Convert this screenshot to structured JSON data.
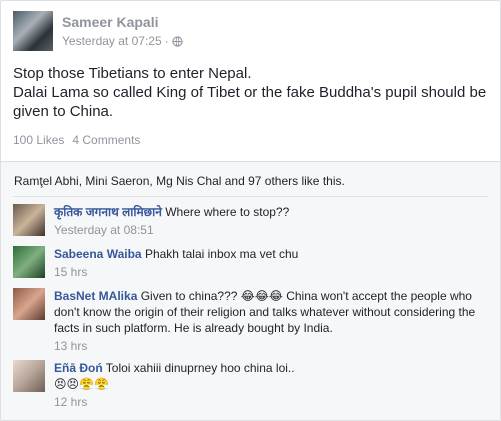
{
  "post": {
    "author": "Sameer Kapali",
    "timestamp": "Yesterday at 07:25",
    "separator": "·",
    "privacy_icon": "globe-icon",
    "text_lines": [
      "Stop those Tibetians to enter Nepal.",
      "Dalai Lama so called King of Tibet or the fake Buddha's pupil should be given to China."
    ],
    "likes": "100 Likes",
    "comments": "4 Comments"
  },
  "reactions_line": "Ramţel Abhi, Mini Saeron, Mg Nis Chal and 97 others like this.",
  "comments": [
    {
      "name": "कृतिक जगनाथ लामिछाने",
      "text": "Where where to stop??",
      "time": "Yesterday at 08:51"
    },
    {
      "name": "Sabeena Waiba",
      "text": "Phakh talai inbox ma vet chu",
      "time": "15 hrs"
    },
    {
      "name": "BasNet MAlika",
      "text_before": "Given to china???",
      "emoji": "😂😂😂",
      "text_after": "China won't accept the people who don't know the origin of their religion and talks whatever without considering the facts in such platform. He is already bought by India.",
      "time": "13 hrs"
    },
    {
      "name": "Eñā Đoń",
      "text": "Toloi xahiii dinuprney hoo china loi..",
      "emoji": "😣😣😤😤",
      "time": "12 hrs"
    }
  ]
}
